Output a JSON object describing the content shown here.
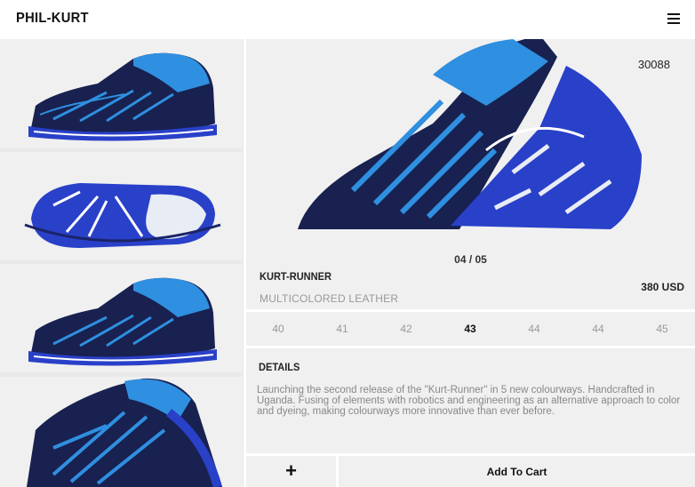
{
  "header": {
    "logo": "PHIL-KURT",
    "menu_icon": "hamburger-menu-icon"
  },
  "product": {
    "code": "30088",
    "image_counter": "04 / 05",
    "name": "KURT-RUNNER",
    "material": "MULTICOLORED LEATHER",
    "price": "380 USD"
  },
  "sizes": [
    {
      "label": "40",
      "selected": false
    },
    {
      "label": "41",
      "selected": false
    },
    {
      "label": "42",
      "selected": false
    },
    {
      "label": "43",
      "selected": true
    },
    {
      "label": "44",
      "selected": false
    },
    {
      "label": "44",
      "selected": false
    },
    {
      "label": "45",
      "selected": false
    }
  ],
  "details": {
    "heading": "DETAILS",
    "text": "Launching the second release of the \"Kurt-Runner\" in 5 new colourways. Handcrafted in Uganda. Fusing of elements with robotics and engineering as an alternative approach to color and dyeing, making colourways more innovative than ever before."
  },
  "actions": {
    "plus_label": "+",
    "add_to_cart_label": "Add To Cart"
  },
  "colors": {
    "shoe_dark": "#18214f",
    "shoe_blue": "#2f8fe0",
    "sole_blue": "#2940c9",
    "panel_bg": "#f0f0f0"
  }
}
